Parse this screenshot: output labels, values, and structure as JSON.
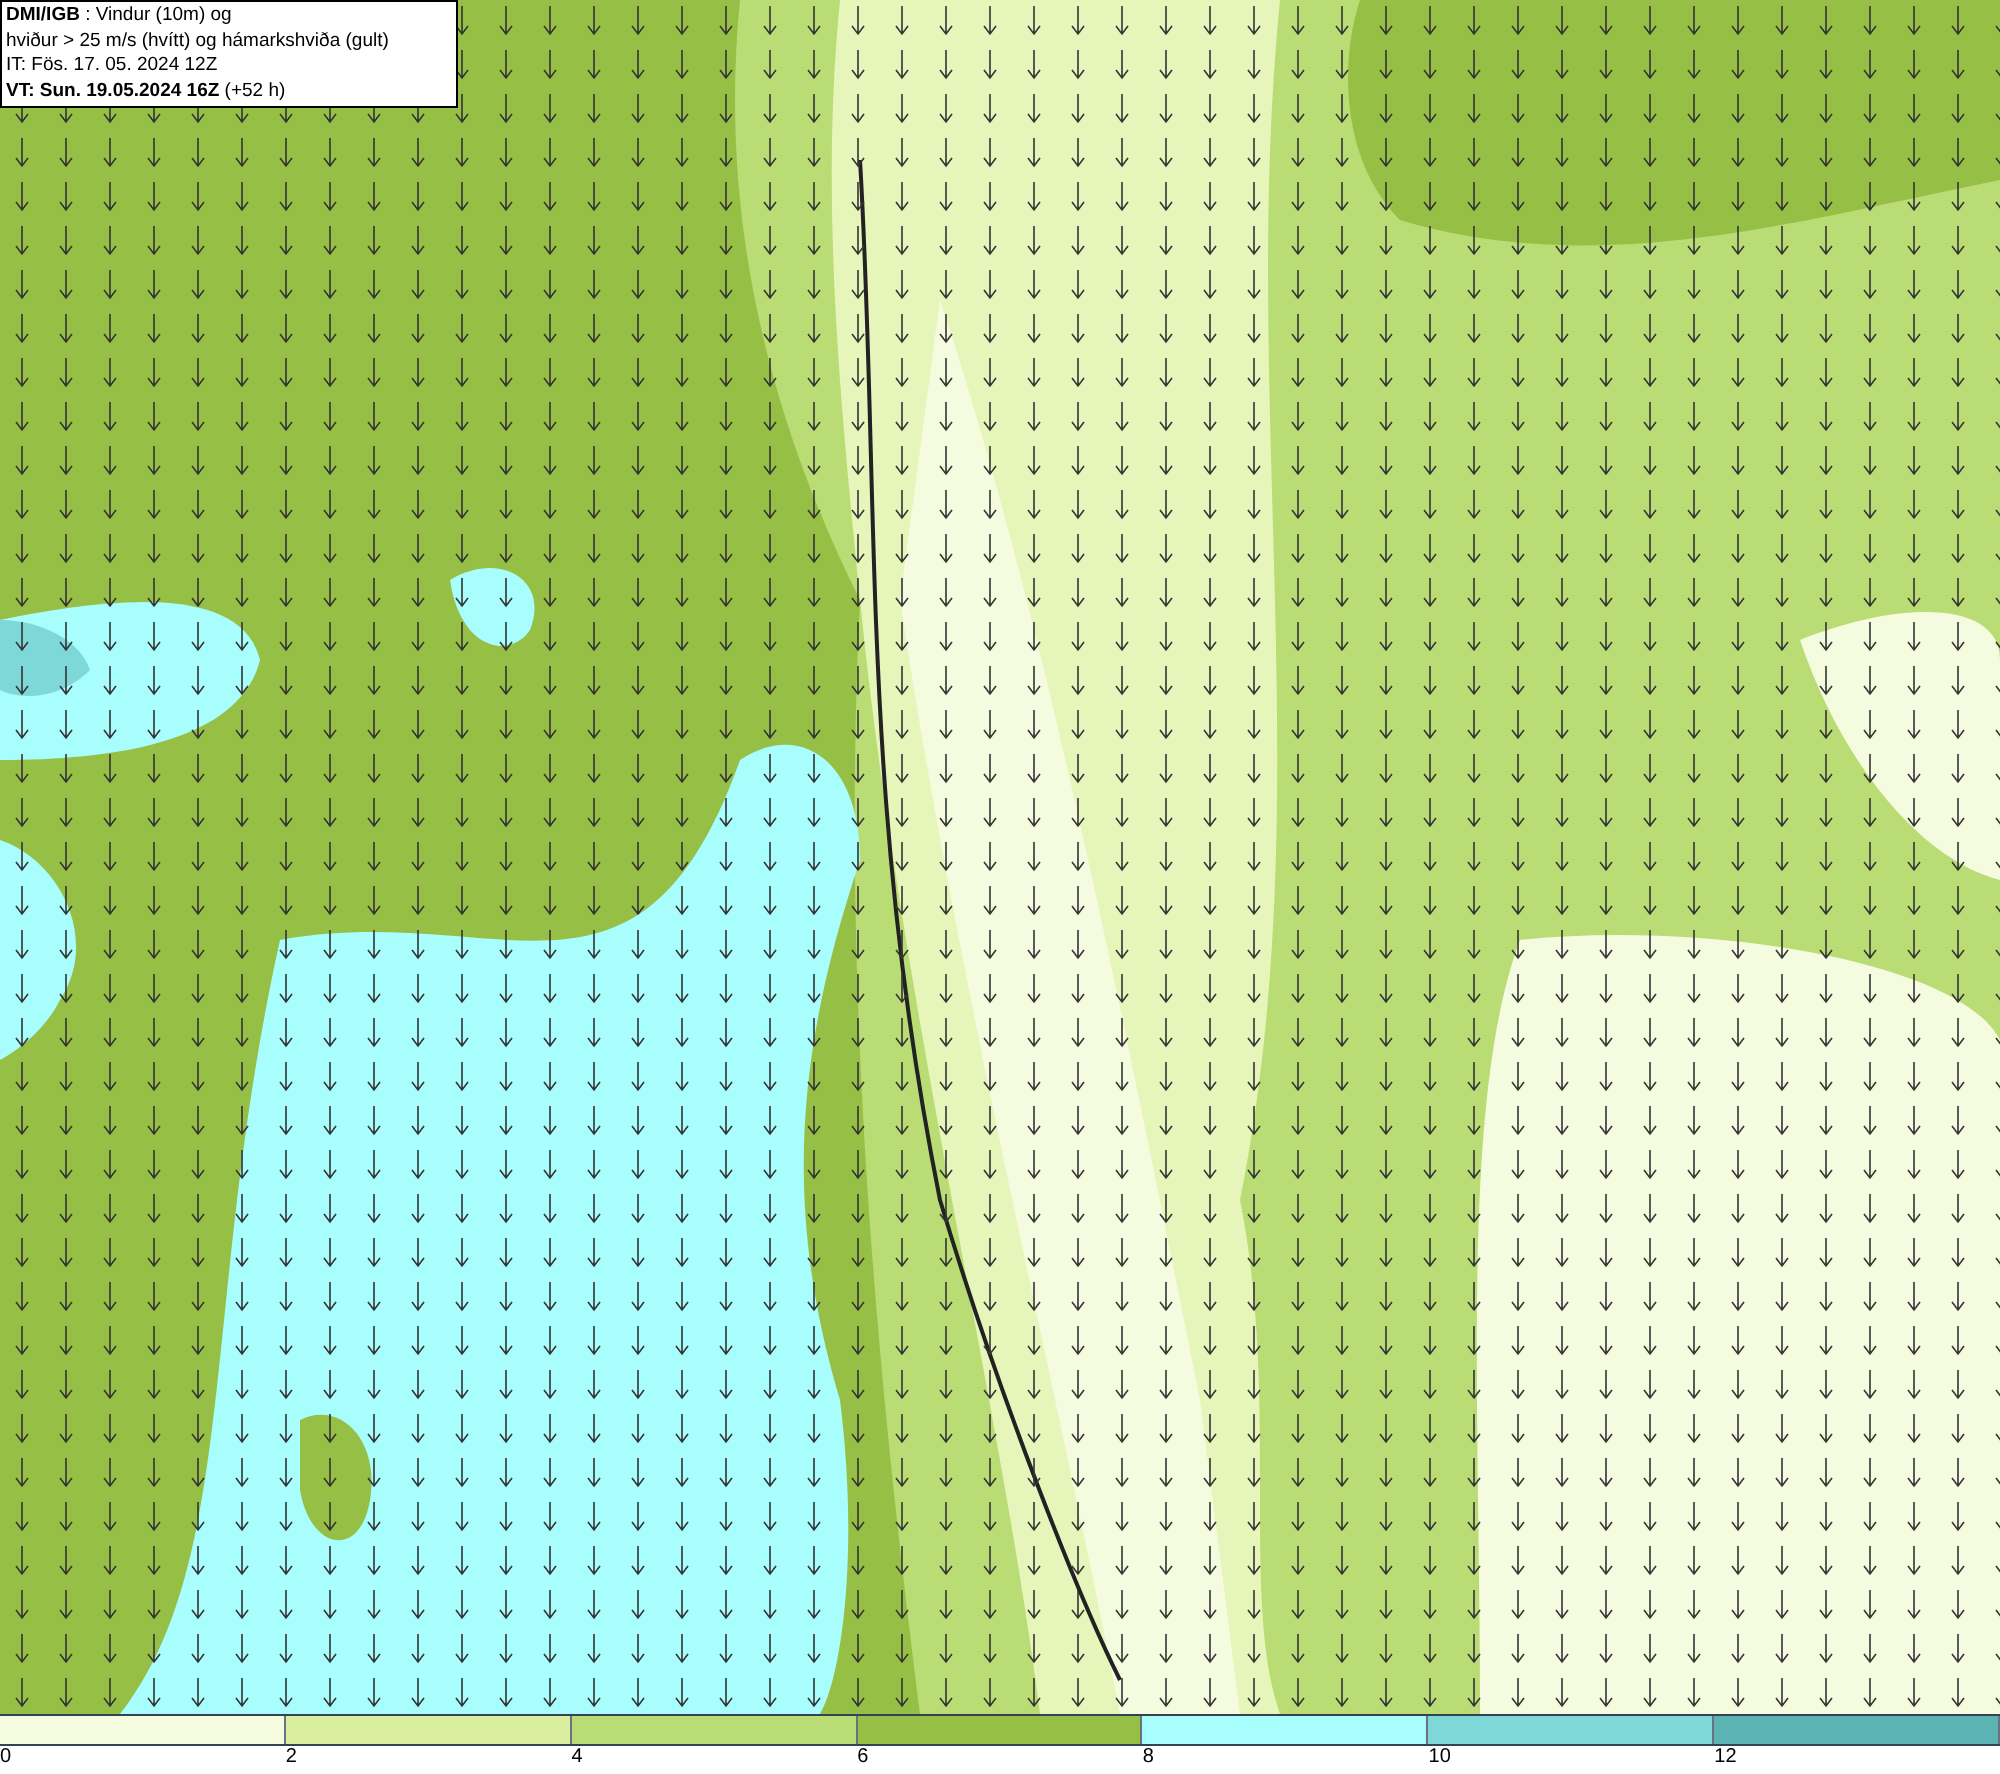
{
  "header": {
    "lines": [
      "**DMI/IGB** : Vindur (10m) og",
      "hviður > 25 m/s (hvítt) og hámarkshviða (gult)",
      "IT: Fös. 17. 05. 2024 12Z",
      "**VT: Sun. 19.05.2024 16Z** (+52 h)"
    ]
  },
  "legend": {
    "bins": [
      {
        "color": "#f5fbdf"
      },
      {
        "color": "#d9ef9f"
      },
      {
        "color": "#b9dc74"
      },
      {
        "color": "#96bf45"
      },
      {
        "color": "#a8fdfd"
      },
      {
        "color": "#7fd8d8"
      },
      {
        "color": "#5bb3b3"
      }
    ],
    "ticks": [
      "0",
      "2",
      "4",
      "6",
      "8",
      "10",
      "12"
    ]
  }
}
